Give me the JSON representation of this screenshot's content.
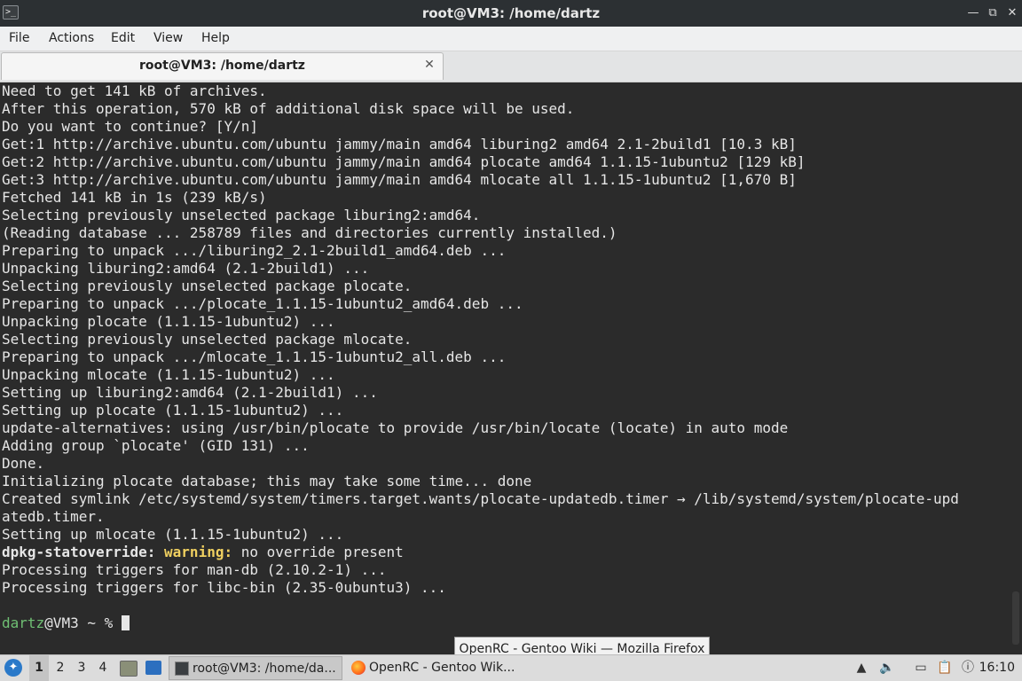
{
  "window": {
    "title": "root@VM3: /home/dartz",
    "icon": "terminal-icon",
    "controls": {
      "minimize": "—",
      "maximize": "⧉",
      "close": "✕"
    }
  },
  "menu": [
    "File",
    "Actions",
    "Edit",
    "View",
    "Help"
  ],
  "tab": {
    "label": "root@VM3: /home/dartz",
    "close": "✕"
  },
  "terminal": {
    "lines": [
      "Need to get 141 kB of archives.",
      "After this operation, 570 kB of additional disk space will be used.",
      "Do you want to continue? [Y/n]",
      "Get:1 http://archive.ubuntu.com/ubuntu jammy/main amd64 liburing2 amd64 2.1-2build1 [10.3 kB]",
      "Get:2 http://archive.ubuntu.com/ubuntu jammy/main amd64 plocate amd64 1.1.15-1ubuntu2 [129 kB]",
      "Get:3 http://archive.ubuntu.com/ubuntu jammy/main amd64 mlocate all 1.1.15-1ubuntu2 [1,670 B]",
      "Fetched 141 kB in 1s (239 kB/s)",
      "Selecting previously unselected package liburing2:amd64.",
      "(Reading database ... 258789 files and directories currently installed.)",
      "Preparing to unpack .../liburing2_2.1-2build1_amd64.deb ...",
      "Unpacking liburing2:amd64 (2.1-2build1) ...",
      "Selecting previously unselected package plocate.",
      "Preparing to unpack .../plocate_1.1.15-1ubuntu2_amd64.deb ...",
      "Unpacking plocate (1.1.15-1ubuntu2) ...",
      "Selecting previously unselected package mlocate.",
      "Preparing to unpack .../mlocate_1.1.15-1ubuntu2_all.deb ...",
      "Unpacking mlocate (1.1.15-1ubuntu2) ...",
      "Setting up liburing2:amd64 (2.1-2build1) ...",
      "Setting up plocate (1.1.15-1ubuntu2) ...",
      "update-alternatives: using /usr/bin/plocate to provide /usr/bin/locate (locate) in auto mode",
      "Adding group `plocate' (GID 131) ...",
      "Done.",
      "Initializing plocate database; this may take some time... done",
      "Created symlink /etc/systemd/system/timers.target.wants/plocate-updatedb.timer → /lib/systemd/system/plocate-upd",
      "atedb.timer.",
      "Setting up mlocate (1.1.15-1ubuntu2) ..."
    ],
    "warning_line": {
      "prefix": "dpkg-statoverride:",
      "label": "warning:",
      "message": " no override present"
    },
    "lines_after": [
      "Processing triggers for man-db (2.10.2-1) ...",
      "Processing triggers for libc-bin (2.35-0ubuntu3) ..."
    ],
    "prompt": {
      "user": "dartz",
      "host_path": "@VM3 ~ % "
    }
  },
  "tooltip": "OpenRC - Gentoo Wiki — Mozilla Firefox",
  "taskbar": {
    "workspaces": [
      "1",
      "2",
      "3",
      "4"
    ],
    "active_workspace": "1",
    "tasks": [
      {
        "label": "root@VM3: /home/da...",
        "icon": "terminal-icon"
      },
      {
        "label": "OpenRC - Gentoo Wik...",
        "icon": "firefox-icon"
      }
    ],
    "tray": [
      "update-icon",
      "volume-icon",
      "network-icon",
      "clipboard-icon",
      "info-icon"
    ],
    "clock": "16:10"
  },
  "colors": {
    "terminal_bg": "#2b2b2b",
    "prompt_user": "#6fbf73",
    "warning": "#f0d060",
    "titlebar": "#2c3033"
  }
}
